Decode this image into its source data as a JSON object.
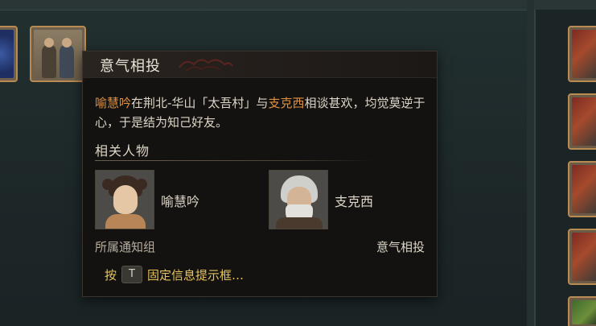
{
  "tooltip": {
    "title": "意气相投",
    "description": {
      "person_a": "喻慧吟",
      "text_1": "在荆北-华山「太吾村」与",
      "person_b": "支克西",
      "text_2": "相谈甚欢，均觉莫逆于心，于是结为知己好友。"
    },
    "section_label": "相关人物",
    "characters": [
      {
        "name": "喻慧吟"
      },
      {
        "name": "支克西"
      }
    ],
    "group_label": "所属通知组",
    "type_label": "意气相投",
    "hint": {
      "prefix": "按",
      "key": "T",
      "suffix": "固定信息提示框…"
    }
  },
  "colors": {
    "highlight": "#e0913f",
    "hint": "#e6c45a",
    "panel_bg": "#141210",
    "slot_border": "#b98a52"
  },
  "icons": {
    "left_slot": "star-map-icon",
    "greet_slot": "greeting-figures-icon",
    "right_slots": [
      "event-icon",
      "event-icon",
      "event-icon",
      "event-icon",
      "scenery-icon"
    ]
  }
}
